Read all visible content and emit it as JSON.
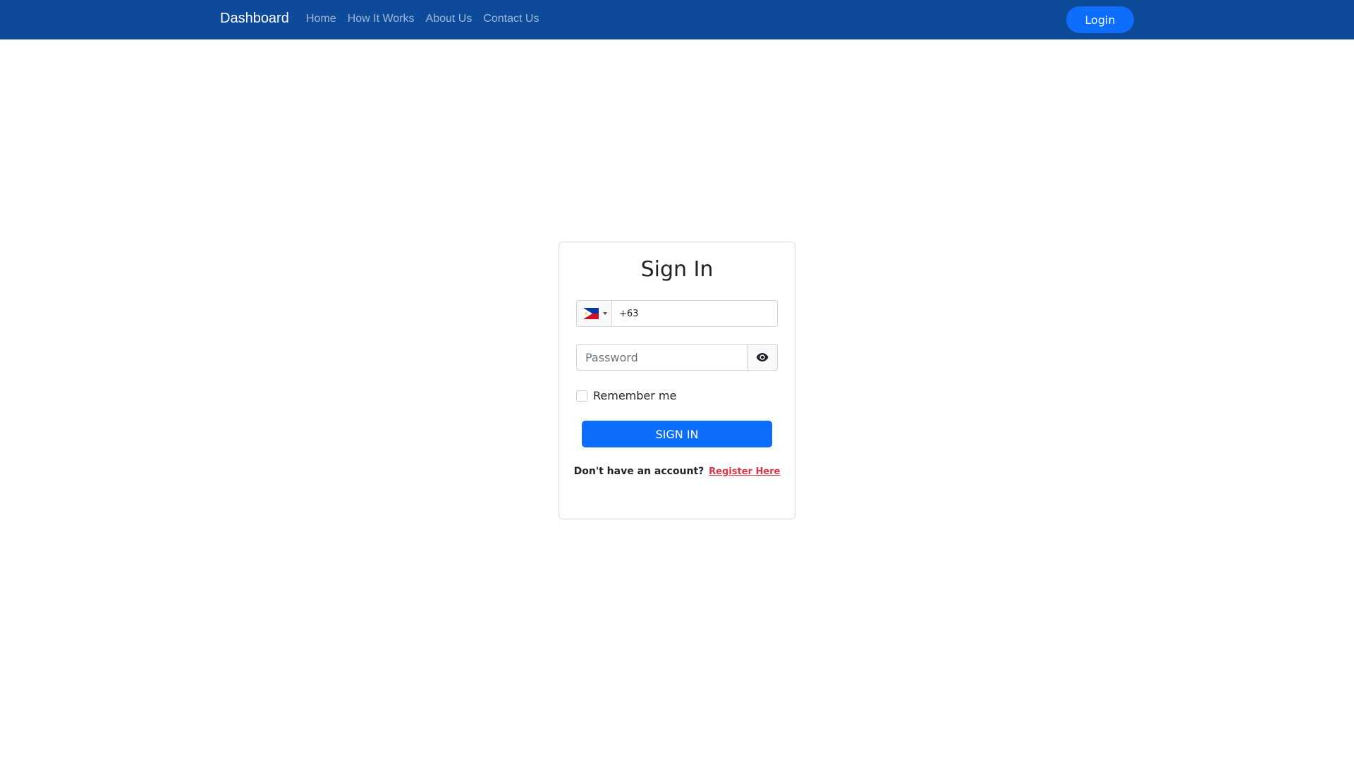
{
  "navbar": {
    "brand": "Dashboard",
    "links": [
      "Home",
      "How It Works",
      "About Us",
      "Contact Us"
    ],
    "login_label": "Login",
    "background_color": "#0d4a9a"
  },
  "signin": {
    "title": "Sign In",
    "phone": {
      "country_flag": "philippines-flag-icon",
      "value": "+63"
    },
    "password": {
      "placeholder": "Password",
      "toggle_icon": "eye-icon"
    },
    "remember_label": "Remember me",
    "submit_label": "SIGN IN",
    "register_prompt": "Don't have an account?",
    "register_link": "Register Here",
    "accent_color": "#0d6efd",
    "link_color": "#dc3545"
  }
}
